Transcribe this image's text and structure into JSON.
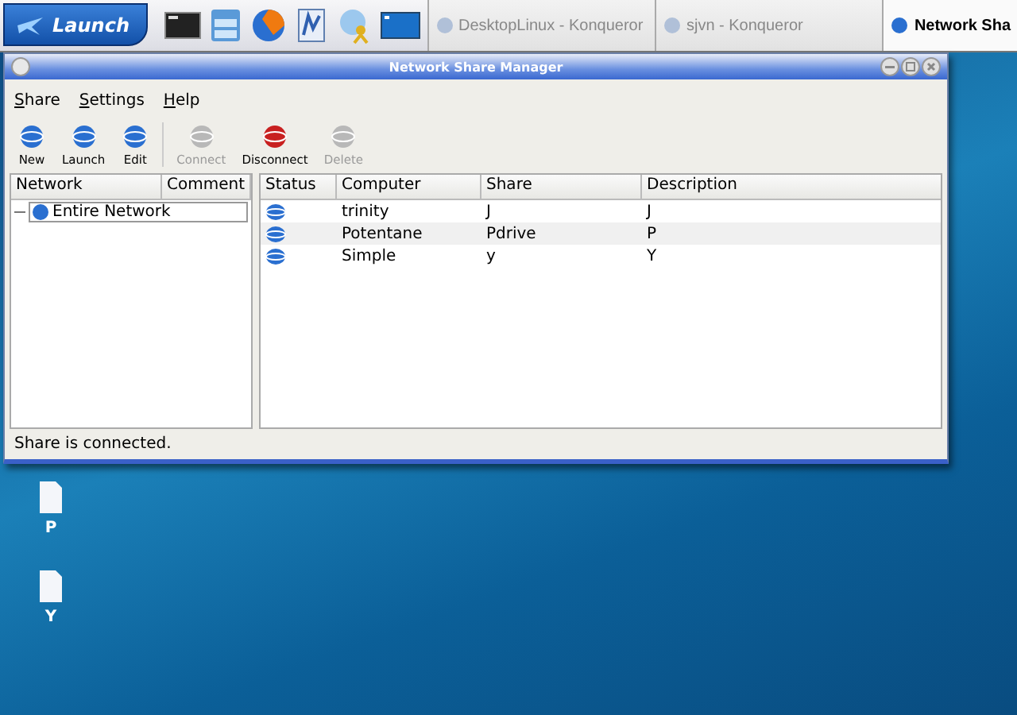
{
  "taskbar": {
    "launch": "Launch",
    "tasks": [
      {
        "label": "DesktopLinux - Konqueror",
        "selected": false
      },
      {
        "label": "sjvn - Konqueror",
        "selected": false
      },
      {
        "label": "Network Sha",
        "selected": true
      }
    ]
  },
  "window": {
    "title": "Network Share Manager"
  },
  "menu": [
    "Share",
    "Settings",
    "Help"
  ],
  "toolbar": [
    {
      "label": "New",
      "disabled": false
    },
    {
      "label": "Launch",
      "disabled": false
    },
    {
      "label": "Edit",
      "disabled": false
    },
    {
      "label": "Connect",
      "disabled": true
    },
    {
      "label": "Disconnect",
      "disabled": false
    },
    {
      "label": "Delete",
      "disabled": true
    }
  ],
  "tree": {
    "columns": [
      "Network",
      "Comment"
    ],
    "items": [
      {
        "label": "Entire Network",
        "expanded": true
      }
    ]
  },
  "table": {
    "columns": [
      "Status",
      "Computer",
      "Share",
      "Description"
    ],
    "rows": [
      {
        "computer": "trinity",
        "share": "J",
        "description": "J"
      },
      {
        "computer": "Potentane",
        "share": "Pdrive",
        "description": "P"
      },
      {
        "computer": "Simple",
        "share": "y",
        "description": "Y"
      }
    ]
  },
  "status_bar": "Share is connected.",
  "desktop_icons": [
    "P",
    "Y"
  ]
}
